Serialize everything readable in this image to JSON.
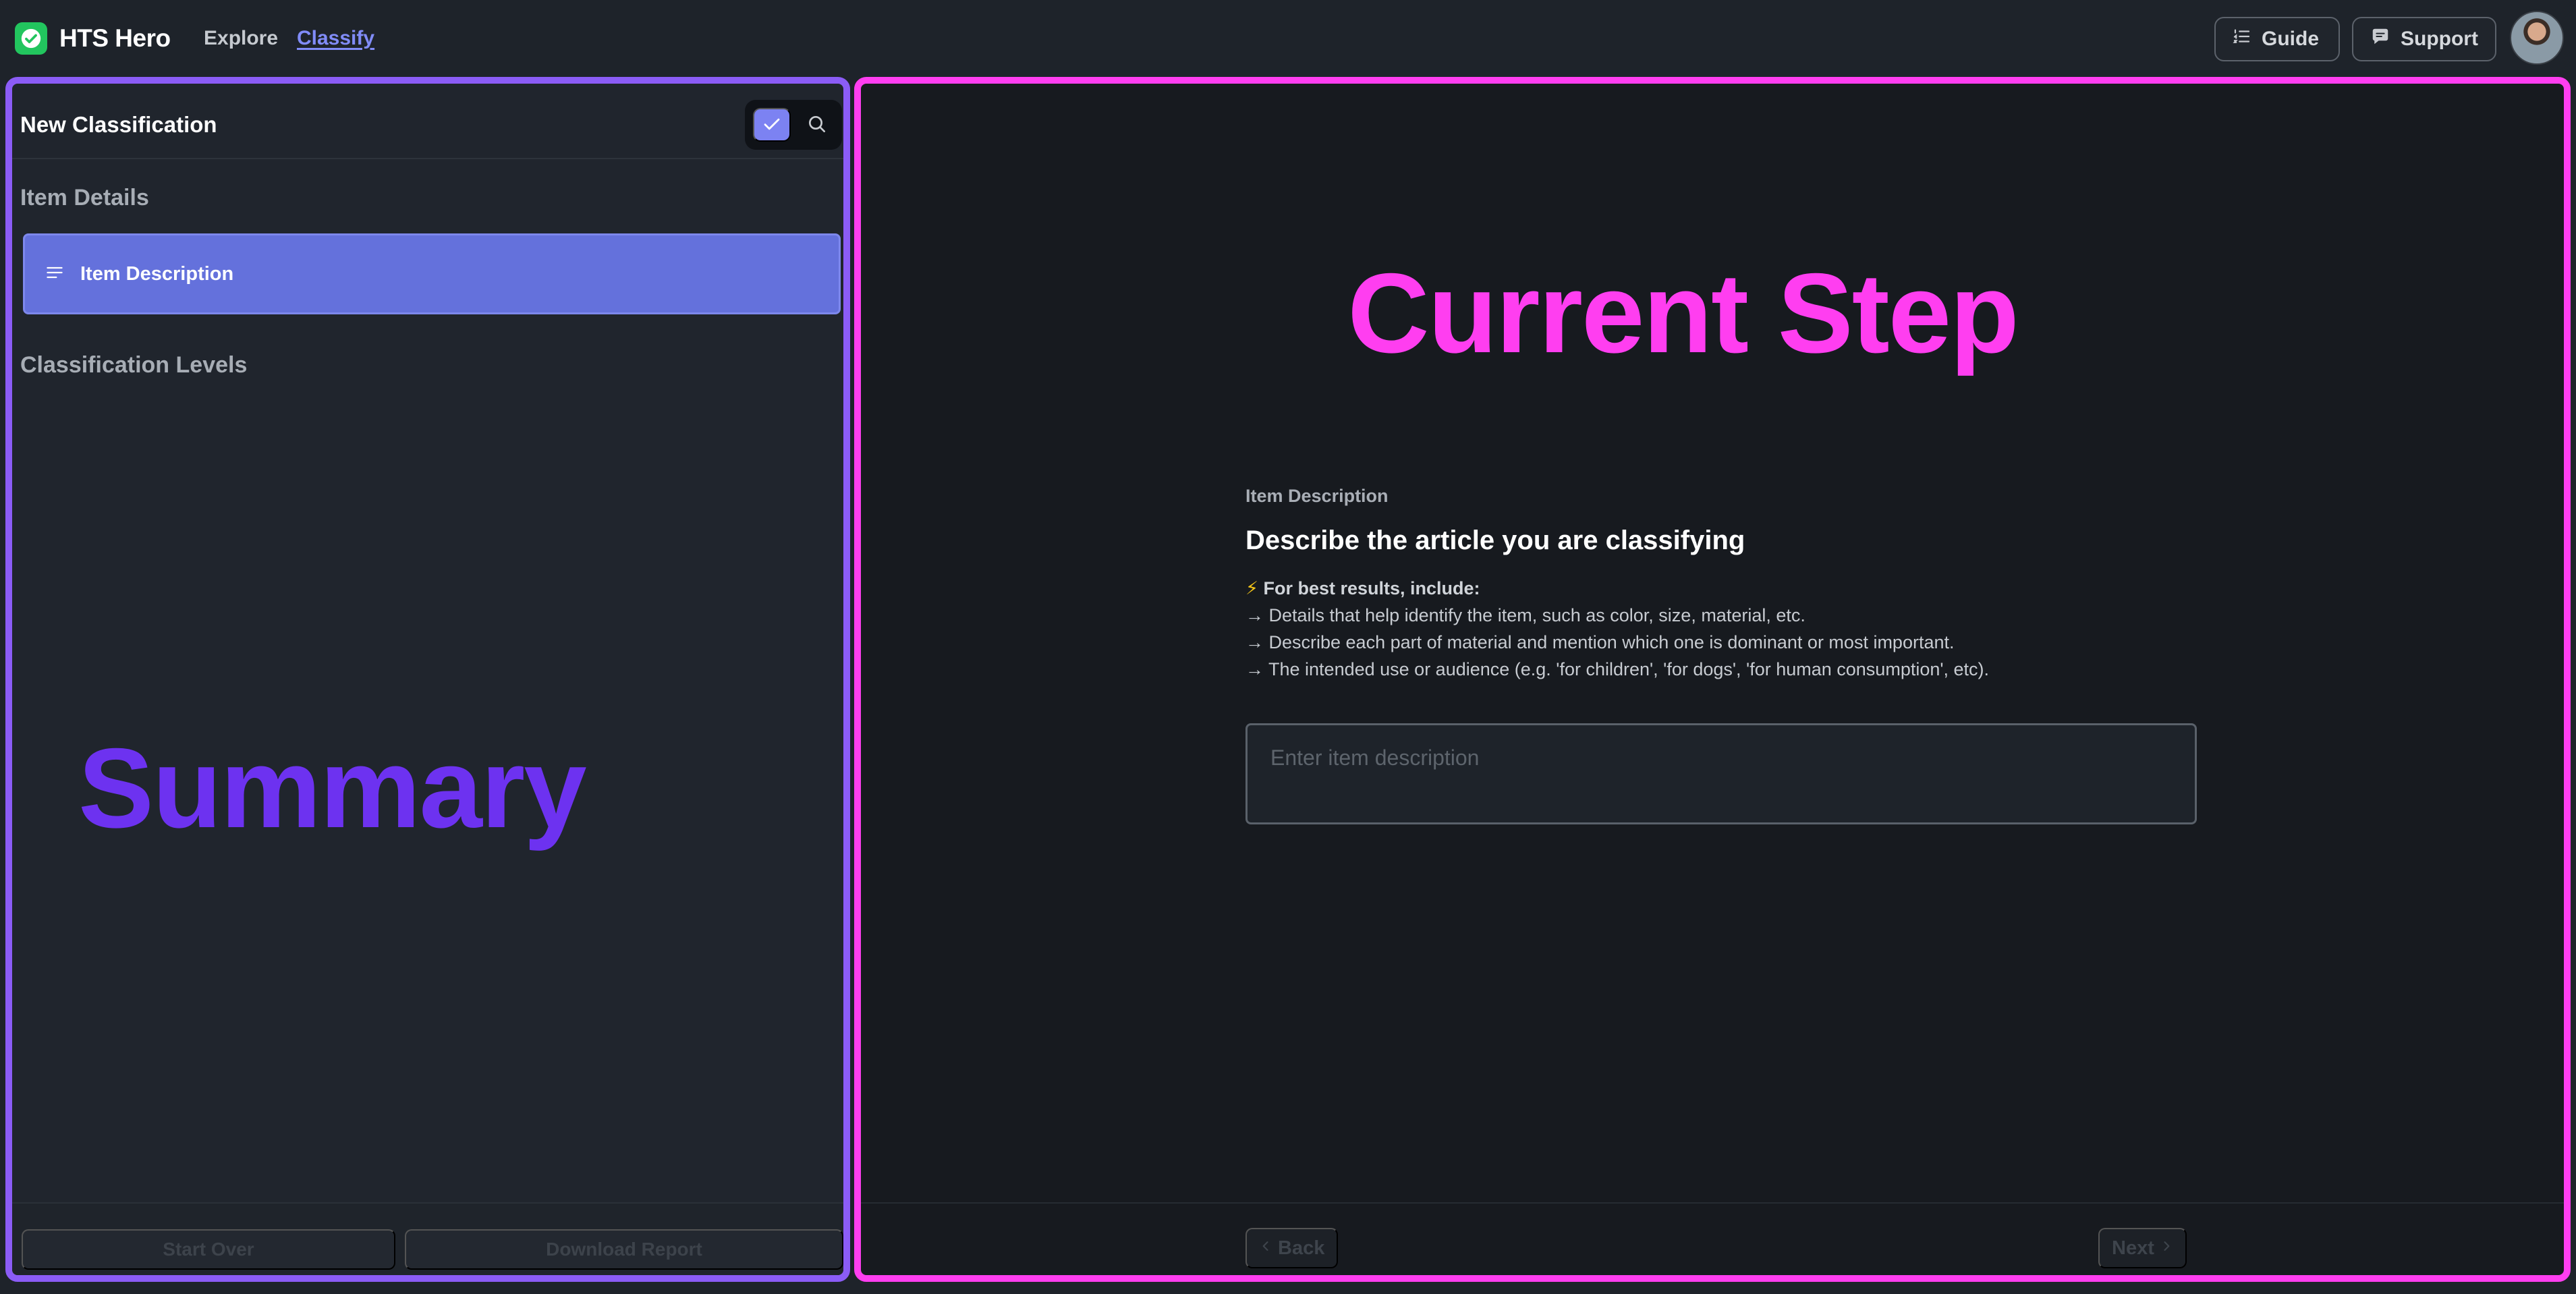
{
  "app": {
    "name": "HTS Hero",
    "nav": [
      {
        "label": "Explore",
        "active": false
      },
      {
        "label": "Classify",
        "active": true
      }
    ],
    "actions": {
      "guide_label": "Guide",
      "support_label": "Support"
    },
    "logo_icon": "check-badge-icon",
    "colors": {
      "brand": "#22c55e",
      "accent": "#818cf8"
    }
  },
  "summary_panel": {
    "title": "New Classification",
    "mode_toggle": {
      "selected": "check",
      "options": [
        "check-icon",
        "search-icon"
      ]
    },
    "sections": {
      "item_details": "Item Details",
      "classification_levels": "Classification Levels"
    },
    "items": [
      {
        "label": "Item Description",
        "icon": "lines-icon",
        "active": true
      }
    ],
    "overlay_label": "Summary",
    "footer": {
      "start_over_label": "Start Over",
      "download_label": "Download Report"
    }
  },
  "step_panel": {
    "overlay_label": "Current Step",
    "kicker": "Item Description",
    "heading": "Describe the article you are classifying",
    "tips_header": "For best results, include:",
    "tips_icon": "⚡",
    "tips": [
      "→ Details that help identify the item, such as color, size, material, etc.",
      "→ Describe each part of material and mention which one is dominant or most important.",
      "→ The intended use or audience (e.g. 'for children', 'for dogs', 'for human consumption', etc)."
    ],
    "input": {
      "placeholder": "Enter item description",
      "value": ""
    },
    "footer": {
      "back_label": "Back",
      "next_label": "Next"
    }
  }
}
